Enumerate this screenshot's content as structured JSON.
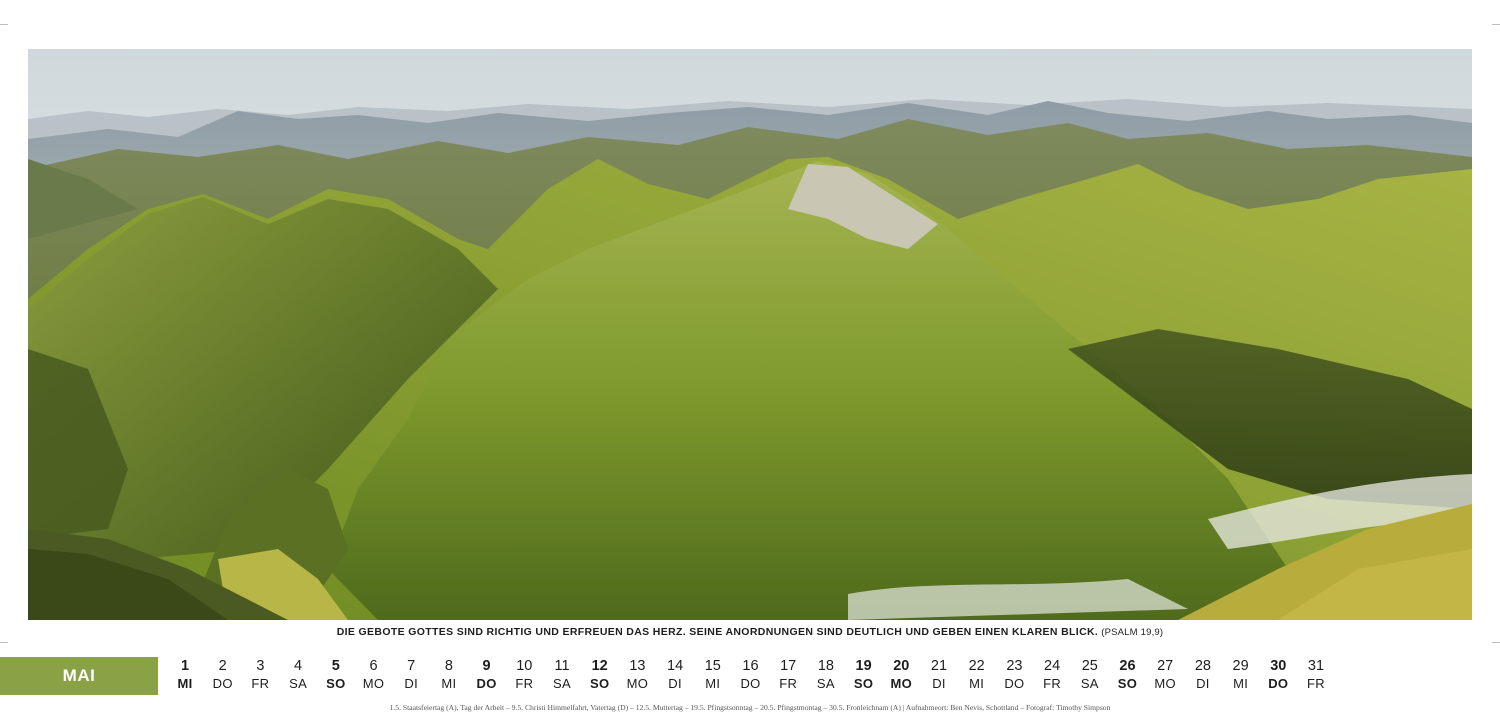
{
  "photo": {
    "subject": "mountain-panorama"
  },
  "verse": {
    "text": "DIE GEBOTE GOTTES SIND RICHTIG UND ERFREUEN DAS HERZ. SEINE ANORDNUNGEN SIND DEUTLICH UND GEBEN EINEN KLAREN BLICK.",
    "reference": "(PSALM 19,9)"
  },
  "calendar": {
    "month": "MAI",
    "accent_color": "#8aa246",
    "days": [
      {
        "num": "1",
        "wd": "MI",
        "bold": true
      },
      {
        "num": "2",
        "wd": "DO",
        "bold": false
      },
      {
        "num": "3",
        "wd": "FR",
        "bold": false
      },
      {
        "num": "4",
        "wd": "SA",
        "bold": false
      },
      {
        "num": "5",
        "wd": "SO",
        "bold": true
      },
      {
        "num": "6",
        "wd": "MO",
        "bold": false
      },
      {
        "num": "7",
        "wd": "DI",
        "bold": false
      },
      {
        "num": "8",
        "wd": "MI",
        "bold": false
      },
      {
        "num": "9",
        "wd": "DO",
        "bold": true
      },
      {
        "num": "10",
        "wd": "FR",
        "bold": false
      },
      {
        "num": "11",
        "wd": "SA",
        "bold": false
      },
      {
        "num": "12",
        "wd": "SO",
        "bold": true
      },
      {
        "num": "13",
        "wd": "MO",
        "bold": false
      },
      {
        "num": "14",
        "wd": "DI",
        "bold": false
      },
      {
        "num": "15",
        "wd": "MI",
        "bold": false
      },
      {
        "num": "16",
        "wd": "DO",
        "bold": false
      },
      {
        "num": "17",
        "wd": "FR",
        "bold": false
      },
      {
        "num": "18",
        "wd": "SA",
        "bold": false
      },
      {
        "num": "19",
        "wd": "SO",
        "bold": true
      },
      {
        "num": "20",
        "wd": "MO",
        "bold": true
      },
      {
        "num": "21",
        "wd": "DI",
        "bold": false
      },
      {
        "num": "22",
        "wd": "MI",
        "bold": false
      },
      {
        "num": "23",
        "wd": "DO",
        "bold": false
      },
      {
        "num": "24",
        "wd": "FR",
        "bold": false
      },
      {
        "num": "25",
        "wd": "SA",
        "bold": false
      },
      {
        "num": "26",
        "wd": "SO",
        "bold": true
      },
      {
        "num": "27",
        "wd": "MO",
        "bold": false
      },
      {
        "num": "28",
        "wd": "DI",
        "bold": false
      },
      {
        "num": "29",
        "wd": "MI",
        "bold": false
      },
      {
        "num": "30",
        "wd": "DO",
        "bold": true
      },
      {
        "num": "31",
        "wd": "FR",
        "bold": false
      }
    ]
  },
  "footnote": "1.5. Staatsfeiertag (A), Tag der Arbeit – 9.5. Christi Himmelfahrt, Vatertag (D) – 12.5. Muttertag – 19.5. Pfingstsonntag – 20.5. Pfingstmontag – 30.5. Fronleichnam (A)  |  Aufnahmeort: Ben Nevis, Schottland – Fotograf: Timothy Simpson"
}
